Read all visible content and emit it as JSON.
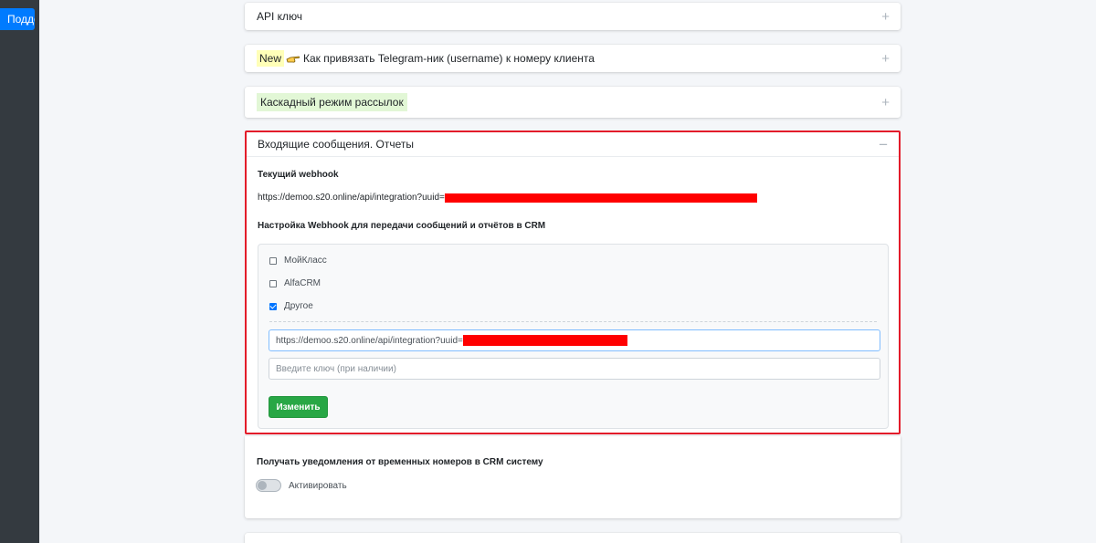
{
  "support_button": "Подде",
  "accordion": {
    "items": [
      {
        "title": "API ключ"
      },
      {
        "badge": "New",
        "title": "Как привязать Telegram-ник (username) к номеру клиента"
      },
      {
        "title": "Каскадный режим рассылок"
      }
    ],
    "open": {
      "title": "Входящие сообщения. Отчеты",
      "current_webhook_label": "Текущий webhook",
      "current_webhook_url": "https://demoo.s20.online/api/integration?uuid=",
      "settings_label": "Настройка Webhook для передачи сообщений и отчётов в CRM",
      "options": [
        {
          "label": "МойКласс",
          "checked": false
        },
        {
          "label": "AlfaCRM",
          "checked": false
        },
        {
          "label": "Другое",
          "checked": true
        }
      ],
      "url_input_value": "https://demoo.s20.online/api/integration?uuid=",
      "key_input_placeholder": "Введите ключ (при наличии)",
      "submit_label": "Изменить"
    }
  },
  "notifications": {
    "label": "Получать уведомления от временных номеров в CRM систему",
    "toggle_label": "Активировать",
    "toggle_on": false
  },
  "colors": {
    "accent": "#007bff",
    "success": "#28a745",
    "highlight_frame": "#e31c2a",
    "redaction": "#ff0000"
  }
}
